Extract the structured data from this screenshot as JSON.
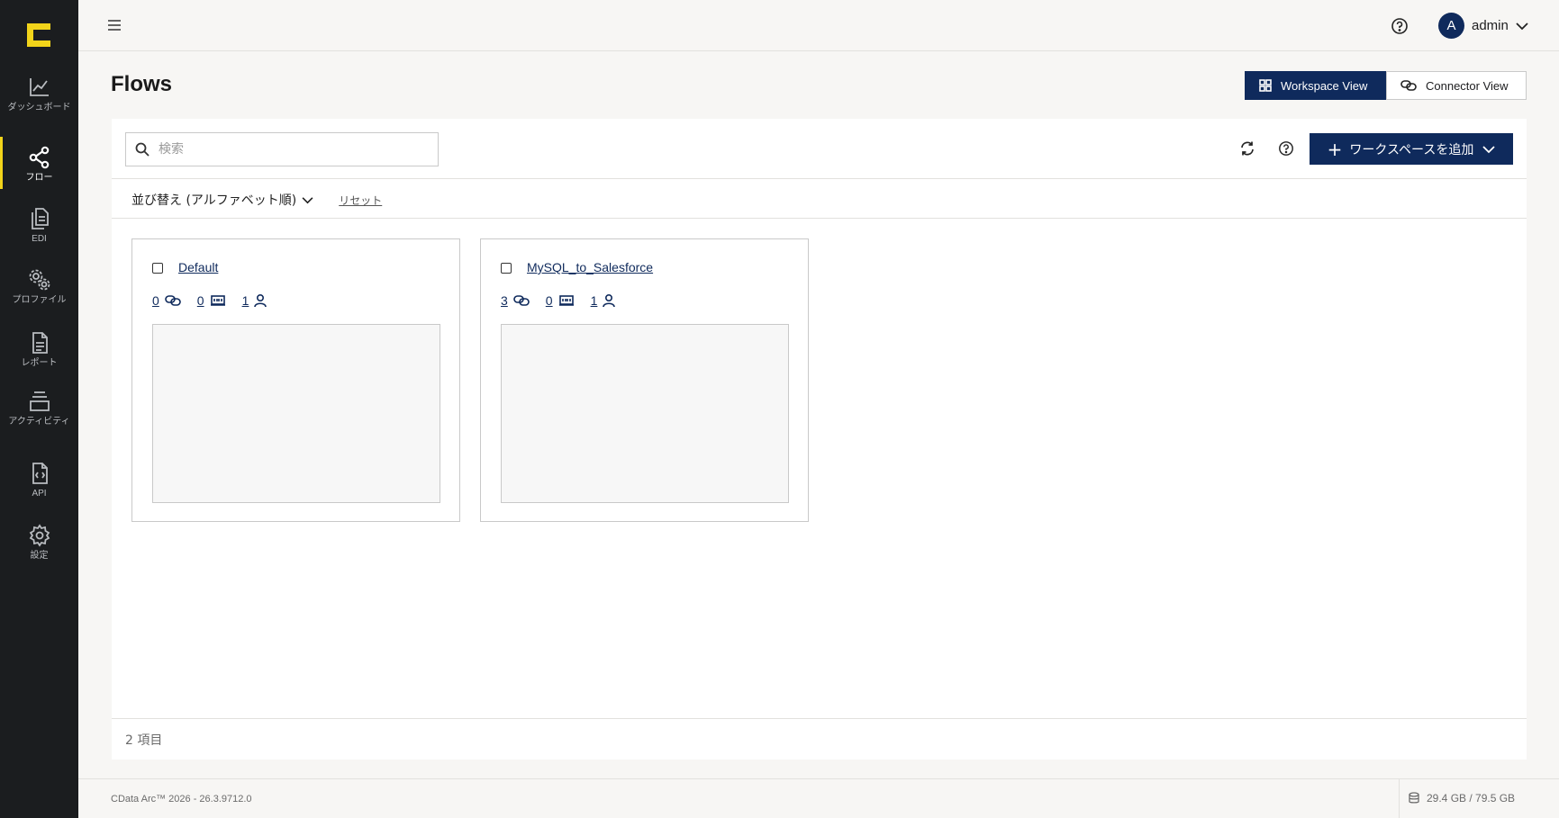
{
  "colors": {
    "sidebar_bg": "#1b1d1f",
    "accent": "#f2d41a",
    "primary": "#0f2a5c"
  },
  "sidebar": {
    "items": [
      {
        "label": "ダッシュボード",
        "icon": "chart-line-icon"
      },
      {
        "label": "フロー",
        "icon": "share-nodes-icon",
        "active": true
      },
      {
        "label": "EDI",
        "icon": "documents-icon"
      },
      {
        "label": "プロファイル",
        "icon": "gears-icon"
      },
      {
        "label": "レポート",
        "icon": "report-icon"
      },
      {
        "label": "アクティビティ",
        "icon": "layers-icon"
      },
      {
        "label": "API",
        "icon": "api-file-icon"
      },
      {
        "label": "設定",
        "icon": "gear-icon"
      }
    ]
  },
  "topbar": {
    "user_initial": "A",
    "username": "admin"
  },
  "page": {
    "title": "Flows",
    "view_toggle": {
      "workspace": "Workspace View",
      "connector": "Connector View",
      "selected": "workspace"
    }
  },
  "toolbar": {
    "search_placeholder": "検索",
    "add_workspace": "ワークスペースを追加",
    "sort_label": "並び替え (アルファベット順)",
    "reset_label": "リセット"
  },
  "workspaces": [
    {
      "name": "Default",
      "connectors": "0",
      "ports": "0",
      "users": "1"
    },
    {
      "name": "MySQL_to_Salesforce",
      "connectors": "3",
      "ports": "0",
      "users": "1"
    }
  ],
  "item_count": "2 項目",
  "footer": {
    "version": "CData Arc™ 2026 - 26.3.9712.0",
    "storage": "29.4 GB / 79.5 GB"
  }
}
